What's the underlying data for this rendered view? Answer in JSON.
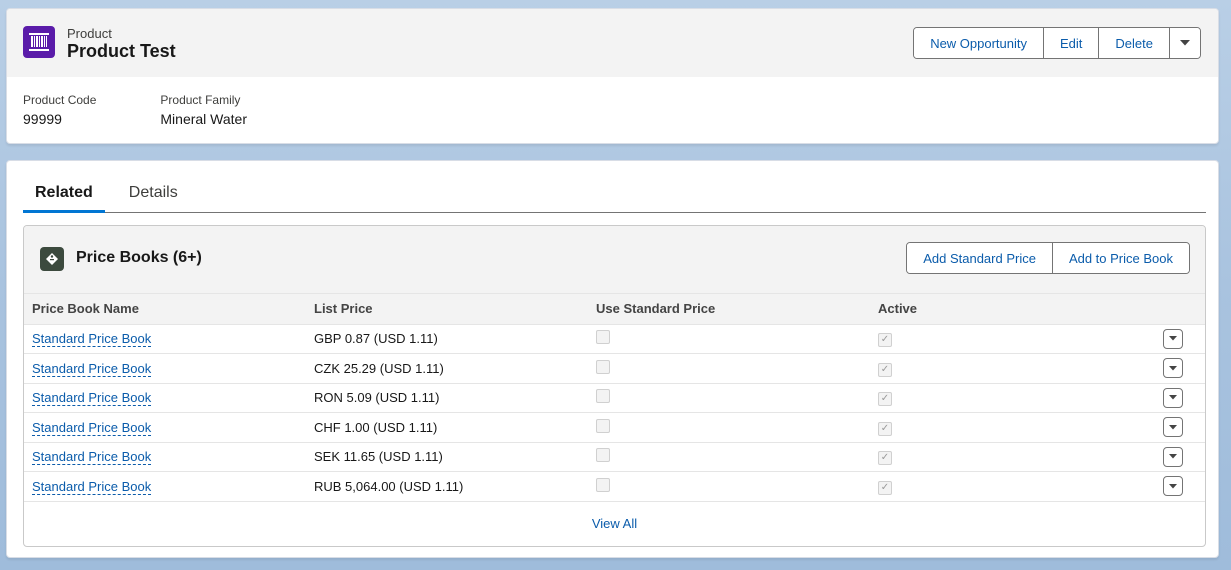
{
  "header": {
    "object_type": "Product",
    "title": "Product Test",
    "icon": "product-icon",
    "icon_color": "#5a1ba9",
    "actions": [
      "New Opportunity",
      "Edit",
      "Delete"
    ],
    "fields": [
      {
        "label": "Product Code",
        "value": "99999"
      },
      {
        "label": "Product Family",
        "value": "Mineral Water"
      }
    ]
  },
  "tabs": [
    {
      "label": "Related",
      "active": true
    },
    {
      "label": "Details",
      "active": false
    }
  ],
  "related_list": {
    "title": "Price Books (6+)",
    "icon": "pricebook-icon",
    "actions": [
      "Add Standard Price",
      "Add to Price Book"
    ],
    "columns": [
      "Price Book Name",
      "List Price",
      "Use Standard Price",
      "Active"
    ],
    "rows": [
      {
        "name": "Standard Price Book",
        "price": "GBP 0.87 (USD 1.11)",
        "use_standard": false,
        "active": true
      },
      {
        "name": "Standard Price Book",
        "price": "CZK 25.29 (USD 1.11)",
        "use_standard": false,
        "active": true
      },
      {
        "name": "Standard Price Book",
        "price": "RON 5.09 (USD 1.11)",
        "use_standard": false,
        "active": true
      },
      {
        "name": "Standard Price Book",
        "price": "CHF 1.00 (USD 1.11)",
        "use_standard": false,
        "active": true
      },
      {
        "name": "Standard Price Book",
        "price": "SEK 11.65 (USD 1.11)",
        "use_standard": false,
        "active": true
      },
      {
        "name": "Standard Price Book",
        "price": "RUB 5,064.00 (USD 1.11)",
        "use_standard": false,
        "active": true
      }
    ],
    "view_all": "View All"
  },
  "colors": {
    "link": "#0b5cab",
    "tab_active_underline": "#0176d3"
  }
}
